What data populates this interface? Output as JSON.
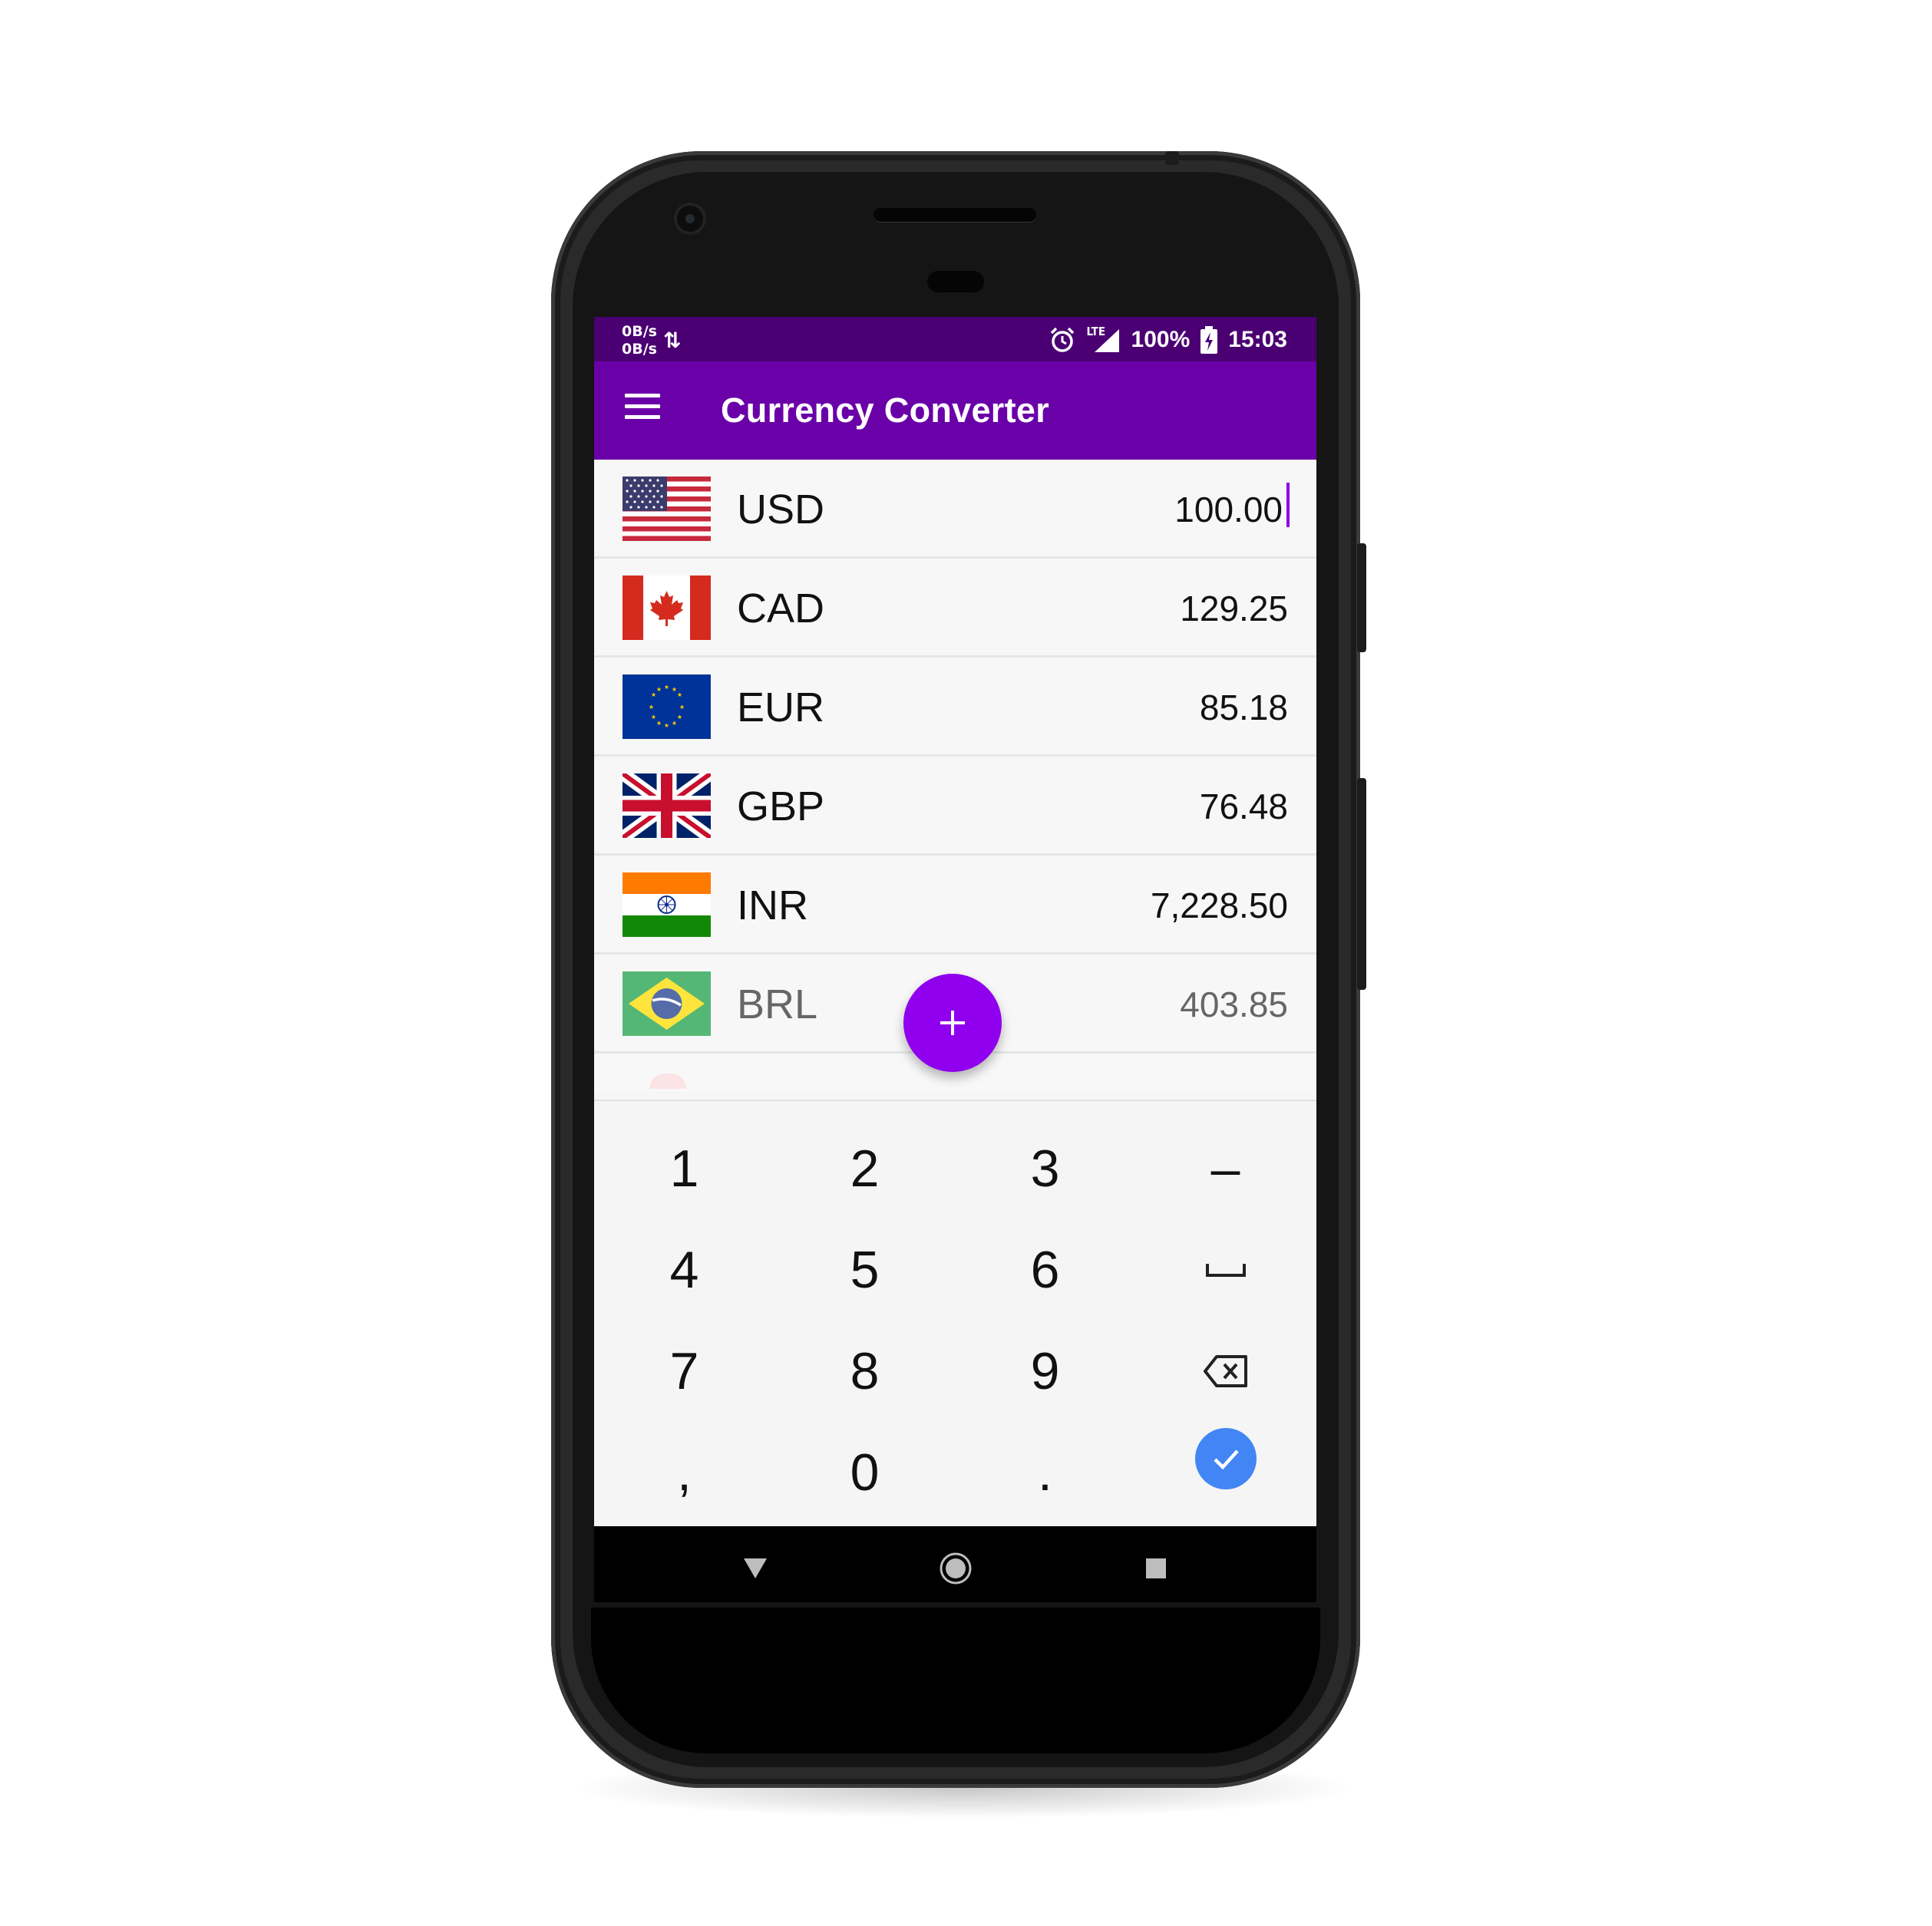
{
  "status_bar": {
    "net_up": "0B/s",
    "net_down": "0B/s",
    "net_icon": "data-arrows-icon",
    "alarm_icon": "alarm-icon",
    "network_type": "LTE",
    "signal_icon": "signal-icon",
    "battery_percent": "100%",
    "battery_icon": "battery-charging-icon",
    "time": "15:03"
  },
  "app_bar": {
    "menu_icon": "hamburger-menu-icon",
    "title": "Currency Converter",
    "color": "#6a00a8",
    "status_color": "#4a0072"
  },
  "currencies": [
    {
      "code": "USD",
      "amount": "100.00",
      "flag": "us-flag-icon",
      "active": true
    },
    {
      "code": "CAD",
      "amount": "129.25",
      "flag": "canada-flag-icon"
    },
    {
      "code": "EUR",
      "amount": "85.18",
      "flag": "eu-flag-icon"
    },
    {
      "code": "GBP",
      "amount": "76.48",
      "flag": "uk-flag-icon"
    },
    {
      "code": "INR",
      "amount": "7,228.50",
      "flag": "india-flag-icon"
    },
    {
      "code": "BRL",
      "amount": "403.85",
      "flag": "brazil-flag-icon"
    }
  ],
  "fab": {
    "label": "+",
    "icon": "plus-icon",
    "color": "#9000ee"
  },
  "keypad": {
    "keys": [
      "1",
      "2",
      "3",
      "–",
      "4",
      "5",
      "6",
      "␣",
      "7",
      "8",
      "9",
      "⌫",
      ",",
      "0",
      ".",
      "✓"
    ],
    "space_icon": "space-key-icon",
    "backspace_icon": "backspace-icon",
    "done_icon": "check-icon",
    "done_color": "#4285f4"
  },
  "nav_bar": {
    "back_icon": "back-triangle-icon",
    "home_icon": "home-circle-icon",
    "recents_icon": "recents-square-icon"
  }
}
